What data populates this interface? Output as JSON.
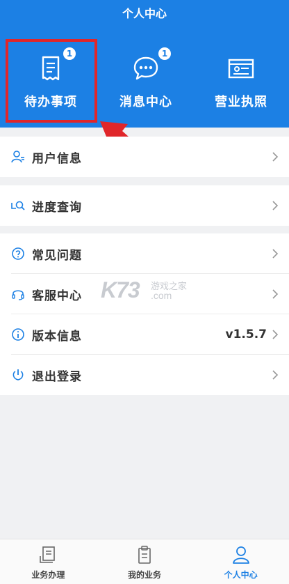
{
  "header": {
    "title": "个人中心",
    "bg_color": "#1c80e4"
  },
  "quick_actions": [
    {
      "label": "待办事项",
      "badge": "1",
      "icon": "todo-document-icon"
    },
    {
      "label": "消息中心",
      "badge": "1",
      "icon": "message-bubble-icon"
    },
    {
      "label": "营业执照",
      "icon": "license-card-icon"
    }
  ],
  "annotation": {
    "box_color": "#e0262a",
    "arrow_color": "#e0262a"
  },
  "menu": {
    "group1": [
      {
        "label": "用户信息",
        "icon": "user-icon"
      }
    ],
    "group2": [
      {
        "label": "进度查询",
        "icon": "search-progress-icon"
      }
    ],
    "group3": [
      {
        "label": "常见问题",
        "icon": "question-icon"
      },
      {
        "label": "客服中心",
        "icon": "headset-icon"
      },
      {
        "label": "版本信息",
        "icon": "info-icon",
        "value": "v1.5.7"
      },
      {
        "label": "退出登录",
        "icon": "power-icon"
      }
    ]
  },
  "watermark": {
    "logo": "K73",
    "line1": "游戏之家",
    "line2": ".com"
  },
  "tabbar": [
    {
      "label": "业务办理",
      "icon": "business-icon"
    },
    {
      "label": "我的业务",
      "icon": "clipboard-icon"
    },
    {
      "label": "个人中心",
      "icon": "person-icon",
      "active": true
    }
  ],
  "accent_color": "#1c80e4"
}
